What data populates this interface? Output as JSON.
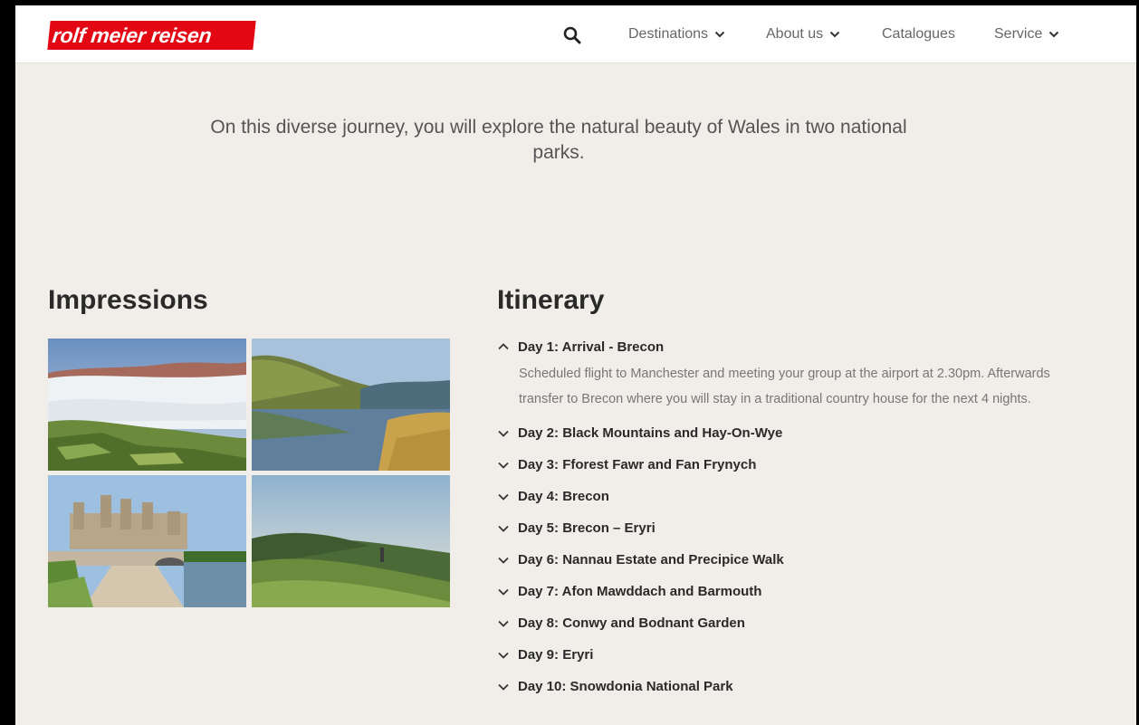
{
  "brand": {
    "logo_text": "rolf meier reisen",
    "logo_color": "#e30613"
  },
  "nav": {
    "search_icon": "search-icon",
    "items": [
      {
        "label": "Destinations",
        "has_dropdown": true
      },
      {
        "label": "About us",
        "has_dropdown": true
      },
      {
        "label": "Catalogues",
        "has_dropdown": false
      },
      {
        "label": "Service",
        "has_dropdown": true
      }
    ]
  },
  "intro": {
    "text": "On this diverse journey, you will explore the natural beauty of Wales in two national parks."
  },
  "impressions": {
    "heading": "Impressions",
    "images": [
      {
        "icon": "valley-fog-photo"
      },
      {
        "icon": "lake-reflection-photo"
      },
      {
        "icon": "castle-bridge-photo"
      },
      {
        "icon": "hiker-hillside-photo"
      }
    ]
  },
  "itinerary": {
    "heading": "Itinerary",
    "days": [
      {
        "title": "Day 1: Arrival - Brecon",
        "expanded": true,
        "description": "Scheduled flight to Manchester and meeting your group at the airport at 2.30pm. Afterwards transfer to Brecon where you will stay in a traditional country house for the next 4 nights."
      },
      {
        "title": "Day 2: Black Mountains and Hay-On-Wye",
        "expanded": false
      },
      {
        "title": "Day 3: Fforest Fawr and Fan Frynych",
        "expanded": false
      },
      {
        "title": "Day 4: Brecon",
        "expanded": false
      },
      {
        "title": "Day 5: Brecon – Eryri",
        "expanded": false
      },
      {
        "title": "Day 6: Nannau Estate and Precipice Walk",
        "expanded": false
      },
      {
        "title": "Day 7: Afon Mawddach and Barmouth",
        "expanded": false
      },
      {
        "title": "Day 8: Conwy and Bodnant Garden",
        "expanded": false
      },
      {
        "title": "Day 9: Eryri",
        "expanded": false
      },
      {
        "title": "Day 10: Snowdonia National Park",
        "expanded": false
      }
    ]
  }
}
